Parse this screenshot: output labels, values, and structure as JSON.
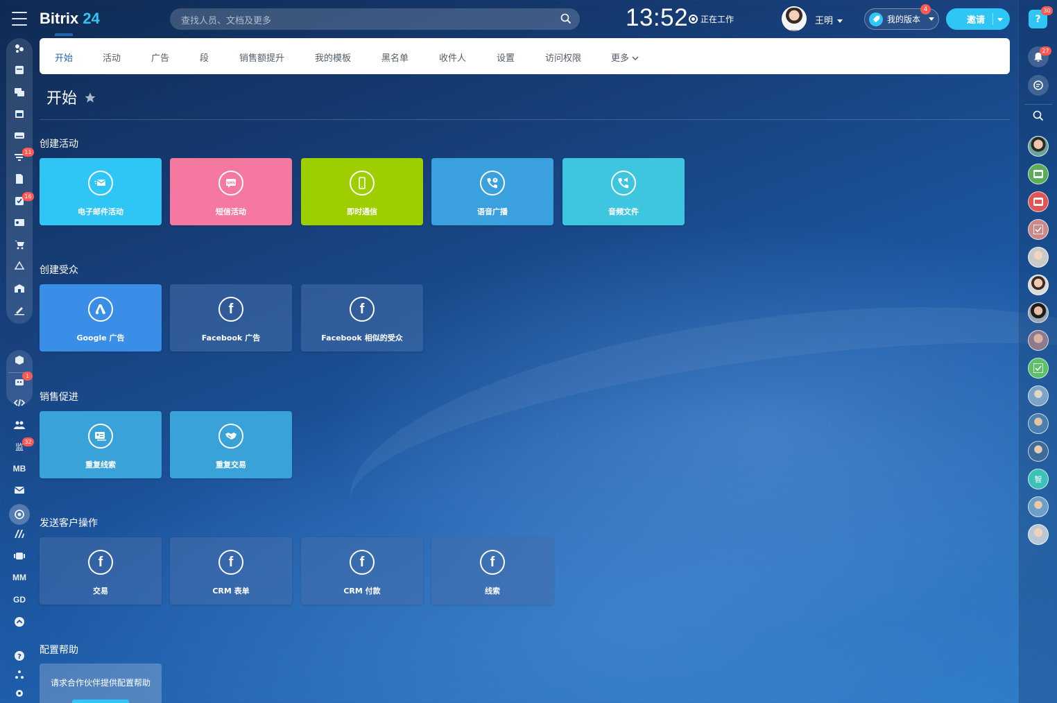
{
  "header": {
    "logo_text": "Bitrix",
    "logo_num": "24",
    "search_placeholder": "查找人员、文档及更多",
    "clock": "13:52",
    "status": "正在工作",
    "user_name": "王明",
    "plan_label": "我的版本",
    "plan_badge": "4",
    "invite_label": "邀请"
  },
  "left_sidebar": {
    "badges": {
      "item6": "11",
      "item8": "16",
      "item14": "1",
      "item17": "32"
    },
    "text_items": {
      "mb": "MB",
      "mm": "MM",
      "gd": "GD"
    }
  },
  "right_sidebar": {
    "help": "?",
    "help_badge": "30",
    "notif_badge": "27",
    "chat_text": "智"
  },
  "tabs": [
    {
      "label": "开始",
      "active": true
    },
    {
      "label": "活动"
    },
    {
      "label": "广告"
    },
    {
      "label": "段"
    },
    {
      "label": "销售额提升"
    },
    {
      "label": "我的模板"
    },
    {
      "label": "黑名单"
    },
    {
      "label": "收件人"
    },
    {
      "label": "设置"
    },
    {
      "label": "访问权限"
    },
    {
      "label": "更多"
    }
  ],
  "page_title": "开始",
  "sections": {
    "create_activity": {
      "title": "创建活动",
      "tiles": [
        {
          "label": "电子邮件活动",
          "color": "#2fc6f6",
          "icon": "email-icon"
        },
        {
          "label": "短信活动",
          "color": "#f4789f",
          "icon": "sms-icon"
        },
        {
          "label": "即时通信",
          "color": "#9dcf00",
          "icon": "mobile-icon"
        },
        {
          "label": "语音广播",
          "color": "#3aa0de",
          "icon": "phone-call-icon"
        },
        {
          "label": "音频文件",
          "color": "#3ec6e0",
          "icon": "phone-audio-icon"
        }
      ]
    },
    "create_audience": {
      "title": "创建受众",
      "tiles": [
        {
          "label": "Google 广告",
          "color": "#3a8ee8",
          "icon": "google-ads-icon"
        },
        {
          "label": "Facebook 广告",
          "icon": "facebook-icon"
        },
        {
          "label": "Facebook 相似的受众",
          "icon": "facebook-icon"
        }
      ]
    },
    "sales_boost": {
      "title": "销售促进",
      "tiles": [
        {
          "label": "重复线索",
          "color": "#39a3d9",
          "icon": "lead-card-icon"
        },
        {
          "label": "重复交易",
          "color": "#39a3d9",
          "icon": "handshake-icon"
        }
      ]
    },
    "send_customer_actions": {
      "title": "发送客户操作",
      "tiles": [
        {
          "label": "交易",
          "icon": "facebook-icon"
        },
        {
          "label": "CRM 表单",
          "icon": "facebook-icon"
        },
        {
          "label": "CRM 付款",
          "icon": "facebook-icon"
        },
        {
          "label": "线索",
          "icon": "facebook-icon"
        }
      ]
    },
    "config_help": {
      "title": "配置帮助",
      "tile_label": "请求合作伙伴提供配置帮助"
    }
  },
  "fb_glyph": "f"
}
